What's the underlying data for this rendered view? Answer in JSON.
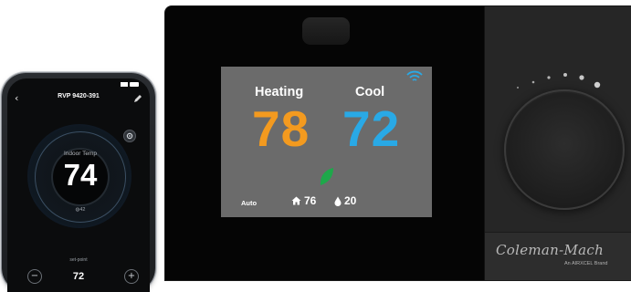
{
  "phone": {
    "device_title": "RVP 9420-391",
    "indoor_label": "Indoor Temp",
    "indoor_temp": "74",
    "humidity_readout": "42",
    "setpoint_label": "set-point",
    "setpoint_value": "72",
    "back_icon": "back-arrow-icon",
    "edit_icon": "pencil-icon",
    "settings_icon": "gear-icon",
    "minus_label": "−",
    "plus_label": "+"
  },
  "thermostat": {
    "heat_label": "Heating",
    "cool_label": "Cool",
    "heat_setpoint": "78",
    "cool_setpoint": "72",
    "fan_mode": "Auto",
    "indoor_temp": "76",
    "humidity": "20",
    "wifi_icon": "wifi-icon",
    "leaf_icon": "leaf-icon",
    "home_icon": "home-icon",
    "drop_icon": "water-drop-icon",
    "brand_logo": "Coleman-Mach",
    "brand_tagline": "An AIRXCEL Brand",
    "colors": {
      "heat": "#f39a1f",
      "cool": "#29a9e6",
      "leaf": "#1ea84a",
      "wifi": "#29a9e6",
      "screen_bg": "#6b6b6b"
    }
  }
}
